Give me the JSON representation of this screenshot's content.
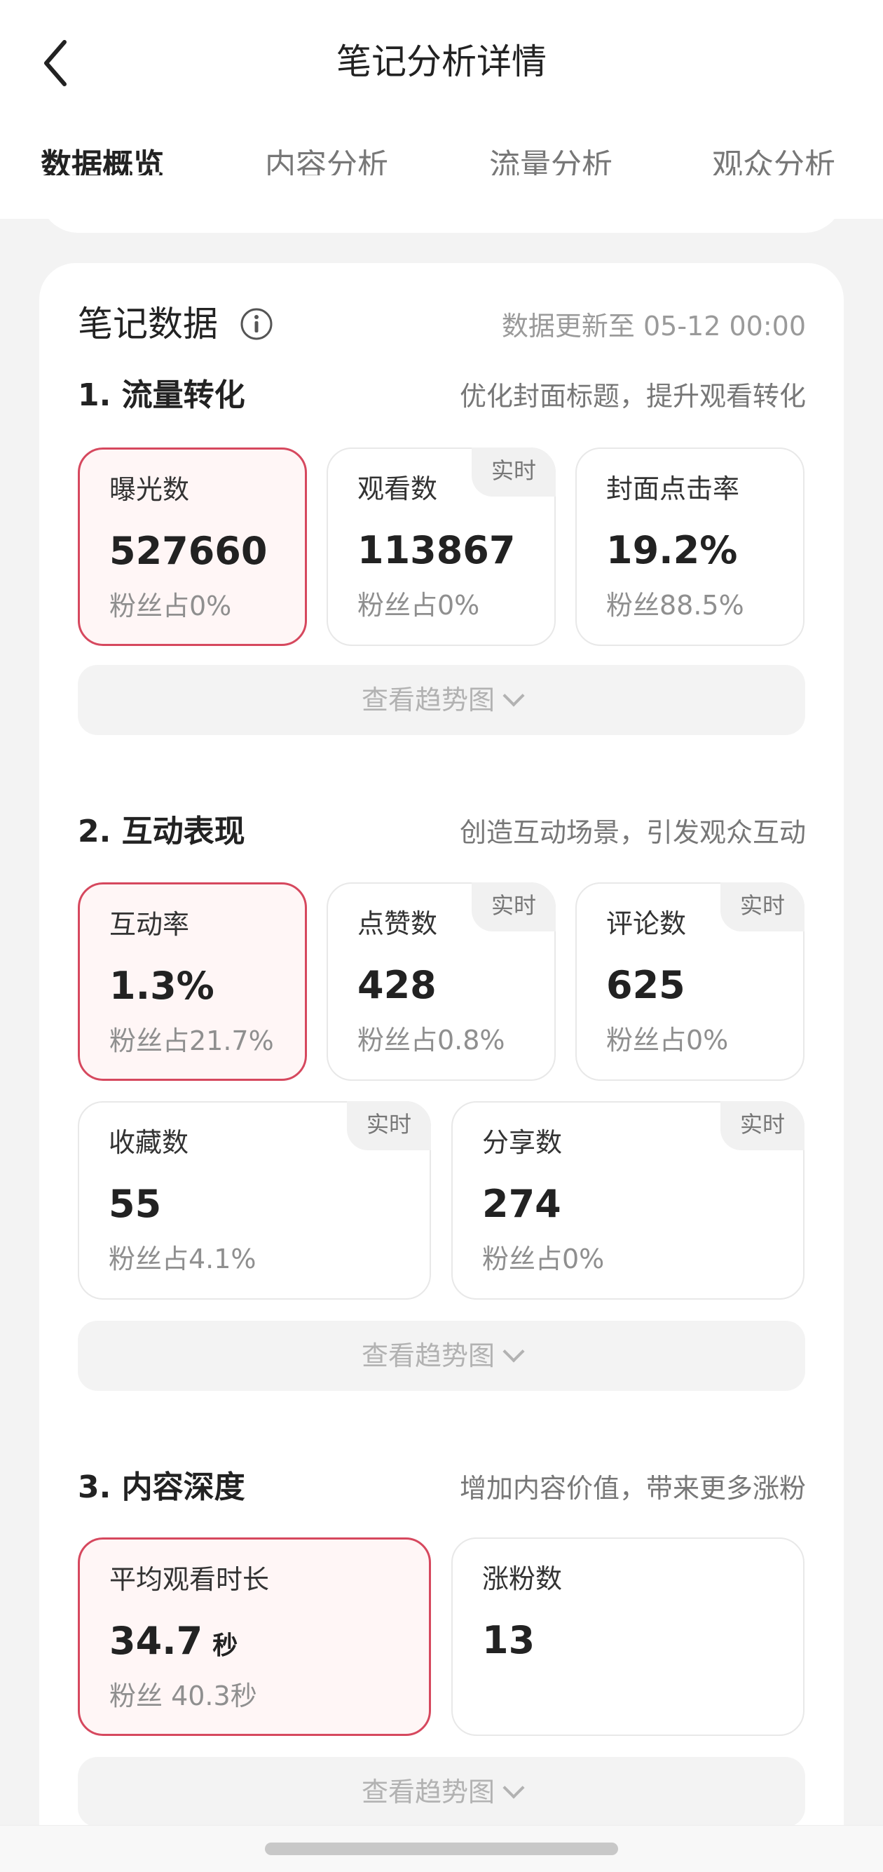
{
  "header": {
    "title": "笔记分析详情",
    "tabs": [
      {
        "label": "数据概览",
        "active": true
      },
      {
        "label": "内容分析",
        "active": false
      },
      {
        "label": "流量分析",
        "active": false
      },
      {
        "label": "观众分析",
        "active": false
      }
    ]
  },
  "card": {
    "title": "笔记数据",
    "update_text": "数据更新至 05-12 00:00"
  },
  "sections": [
    {
      "title": "1. 流量转化",
      "hint": "优化封面标题，提升观看转化",
      "metrics": [
        {
          "label": "曝光数",
          "value": "527660",
          "sub": "粉丝占0%",
          "badge": "",
          "highlighted": true
        },
        {
          "label": "观看数",
          "value": "113867",
          "sub": "粉丝占0%",
          "badge": "实时",
          "highlighted": false
        },
        {
          "label": "封面点击率",
          "value": "19.2%",
          "sub": "粉丝88.5%",
          "badge": "",
          "highlighted": false
        }
      ],
      "trend_label": "查看趋势图"
    },
    {
      "title": "2. 互动表现",
      "hint": "创造互动场景，引发观众互动",
      "metrics": [
        {
          "label": "互动率",
          "value": "1.3%",
          "sub": "粉丝占21.7%",
          "badge": "",
          "highlighted": true
        },
        {
          "label": "点赞数",
          "value": "428",
          "sub": "粉丝占0.8%",
          "badge": "实时",
          "highlighted": false
        },
        {
          "label": "评论数",
          "value": "625",
          "sub": "粉丝占0%",
          "badge": "实时",
          "highlighted": false
        },
        {
          "label": "收藏数",
          "value": "55",
          "sub": "粉丝占4.1%",
          "badge": "实时",
          "highlighted": false
        },
        {
          "label": "分享数",
          "value": "274",
          "sub": "粉丝占0%",
          "badge": "实时",
          "highlighted": false
        }
      ],
      "trend_label": "查看趋势图"
    },
    {
      "title": "3. 内容深度",
      "hint": "增加内容价值，带来更多涨粉",
      "metrics": [
        {
          "label": "平均观看时长",
          "value": "34.7",
          "unit": "秒",
          "sub": "粉丝 40.3秒",
          "badge": "",
          "highlighted": true
        },
        {
          "label": "涨粉数",
          "value": "13",
          "sub": "",
          "badge": "",
          "highlighted": false
        }
      ],
      "trend_label": "查看趋势图"
    }
  ],
  "colors": {
    "accent": "#e0324c",
    "highlight_border": "#d6485e",
    "highlight_bg": "#fff6f6",
    "page_bg": "#f3f3f3"
  },
  "icons": {
    "back": "chevron-left-icon",
    "info": "info-icon",
    "trend": "chevron-down-icon"
  }
}
